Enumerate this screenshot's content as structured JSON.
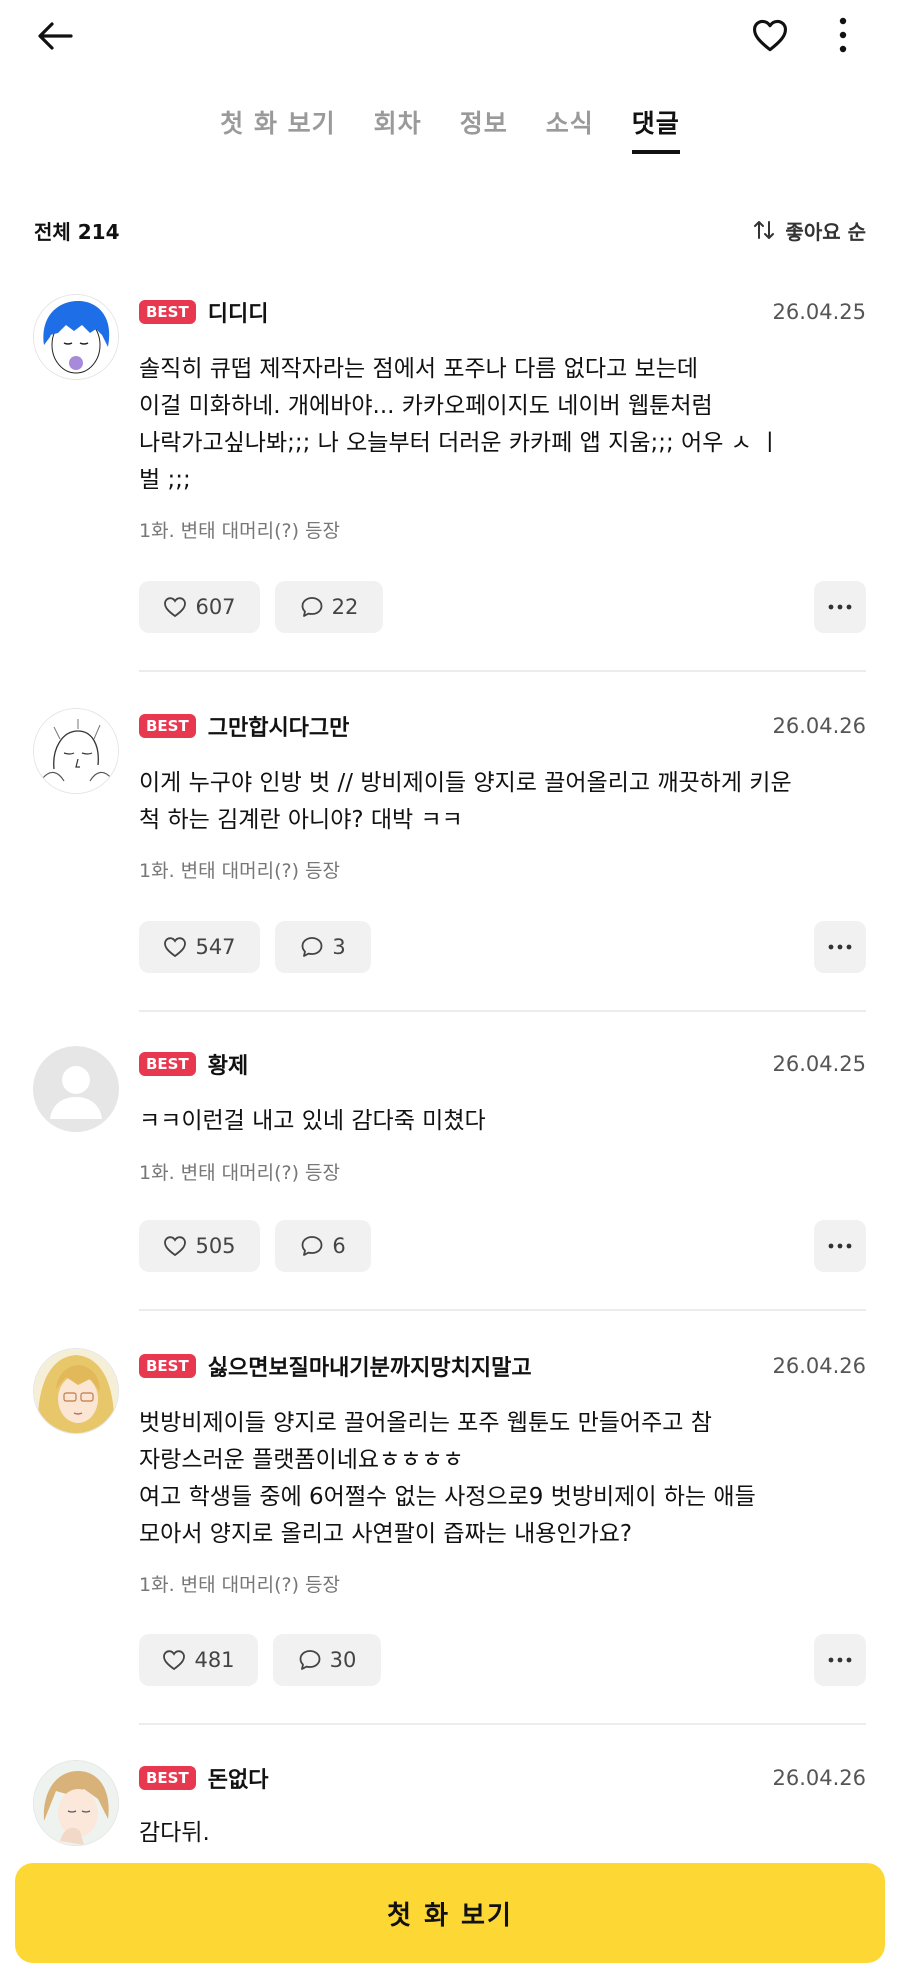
{
  "tabs": [
    "첫 화 보기",
    "회차",
    "정보",
    "소식",
    "댓글"
  ],
  "active_tab_index": 4,
  "summary": {
    "total": "전체 214",
    "sort_label": "좋아요 순"
  },
  "comments": [
    {
      "badge": "BEST",
      "nickname": "디디디",
      "date": "26.04.25",
      "lines": [
        "솔직히 큐떱 제작자라는 점에서 포주나 다름 없다고 보는데",
        "이걸 미화하네. 개에바야... 카카오페이지도 네이버 웹툰처럼",
        "나락가고싶나봐;;; 나 오늘부터 더러운 카카페 앱 지움;;; 어우 ㅅ ㅣ",
        "벌 ;;;"
      ],
      "episode": "1화. 변태 대머리(?) 등장",
      "likes": "607",
      "replies": "22"
    },
    {
      "badge": "BEST",
      "nickname": "그만합시다그만",
      "date": "26.04.26",
      "lines": [
        "이게 누구야 인방 벗  // 방비제이들 양지로 끌어올리고 깨끗하게 키운",
        "척 하는 김계란 아니야? 대박 ㅋㅋ"
      ],
      "episode": "1화. 변태 대머리(?) 등장",
      "likes": "547",
      "replies": "3"
    },
    {
      "badge": "BEST",
      "nickname": "황제",
      "date": "26.04.25",
      "lines": [
        "ㅋㅋ이런걸 내고 있네 감다죽 미쳤다"
      ],
      "episode": "1화. 변태 대머리(?) 등장",
      "likes": "505",
      "replies": "6"
    },
    {
      "badge": "BEST",
      "nickname": "싫으면보질마내기분까지망치지말고",
      "date": "26.04.26",
      "lines": [
        "벗방비제이들 양지로 끌어올리는 포주 웹툰도 만들어주고 참",
        "자랑스러운 플랫폼이네요ㅎㅎㅎㅎ",
        "여고 학생들 중에 6어쩔수 없는 사정으로9 벗방비제이 하는 애들",
        "모아서 양지로 올리고 사연팔이 즙짜는 내용인가요?"
      ],
      "episode": "1화. 변태 대머리(?) 등장",
      "likes": "481",
      "replies": "30"
    },
    {
      "badge": "BEST",
      "nickname": "돈없다",
      "date": "26.04.26",
      "lines": [
        "감다뒤."
      ],
      "episode": "",
      "likes": "",
      "replies": ""
    }
  ],
  "cta_label": "첫 화 보기",
  "colors": {
    "best_badge": "#e8384f",
    "cta": "#fdd835"
  },
  "icons": [
    "back-arrow-icon",
    "heart-icon",
    "more-vertical-icon",
    "sort-icon",
    "like-heart-icon",
    "reply-bubble-icon",
    "more-horizontal-icon"
  ]
}
